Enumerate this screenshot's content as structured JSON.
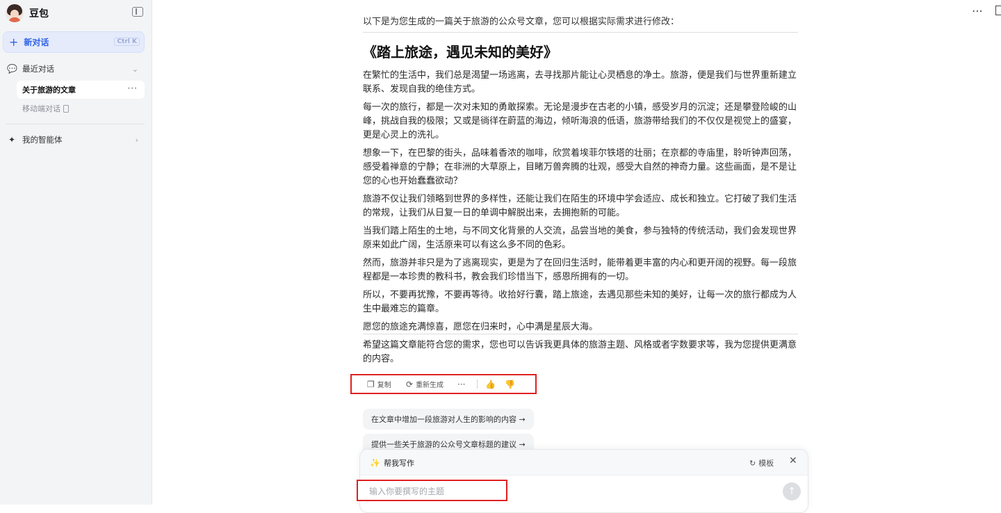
{
  "sidebar": {
    "brand_name": "豆包",
    "new_chat_label": "新对话",
    "new_chat_shortcut": "Ctrl K",
    "recent_label": "最近对话",
    "recent_items": [
      {
        "label": "关于旅游的文章",
        "active": true
      }
    ],
    "mobile_label": "移动端对话",
    "agents_label": "我的智能体"
  },
  "main": {
    "intro": "以下是为您生成的一篇关于旅游的公众号文章，您可以根据实际需求进行修改：",
    "title": "《踏上旅途，遇见未知的美好》",
    "paragraphs": [
      "在繁忙的生活中，我们总是渴望一场逃离，去寻找那片能让心灵栖息的净土。旅游，便是我们与世界重新建立联系、发现自我的绝佳方式。",
      "每一次的旅行，都是一次对未知的勇敢探索。无论是漫步在古老的小镇，感受岁月的沉淀；还是攀登险峻的山峰，挑战自我的极限；又或是徜徉在蔚蓝的海边，倾听海浪的低语，旅游带给我们的不仅仅是视觉上的盛宴，更是心灵上的洗礼。",
      "想象一下，在巴黎的街头，品味着香浓的咖啡，欣赏着埃菲尔铁塔的壮丽；在京都的寺庙里，聆听钟声回荡，感受着禅意的宁静；在非洲的大草原上，目睹万兽奔腾的壮观，感受大自然的神奇力量。这些画面，是不是让您的心也开始蠢蠢欲动？",
      "旅游不仅让我们领略到世界的多样性，还能让我们在陌生的环境中学会适应、成长和独立。它打破了我们生活的常规，让我们从日复一日的单调中解脱出来，去拥抱新的可能。",
      "当我们踏上陌生的土地，与不同文化背景的人交流，品尝当地的美食，参与独特的传统活动，我们会发现世界原来如此广阔，生活原来可以有这么多不同的色彩。",
      "然而，旅游并非只是为了逃离现实，更是为了在回归生活时，能带着更丰富的内心和更开阔的视野。每一段旅程都是一本珍贵的教科书，教会我们珍惜当下，感恩所拥有的一切。",
      "所以，不要再犹豫，不要再等待。收拾好行囊，踏上旅途，去遇见那些未知的美好，让每一次的旅行都成为人生中最难忘的篇章。",
      "愿您的旅途充满惊喜，愿您在归来时，心中满是星辰大海。"
    ],
    "outro": "希望这篇文章能符合您的需求，您也可以告诉我更具体的旅游主题、风格或者字数要求等，我为您提供更满意的内容。",
    "actions": {
      "copy_label": "复制",
      "regenerate_label": "重新生成"
    },
    "suggestions": [
      "在文章中增加一段旅游对人生的影响的内容 →",
      "提供一些关于旅游的公众号文章标题的建议 →"
    ]
  },
  "composer": {
    "mode_label": "帮我写作",
    "template_label": "模板",
    "input_placeholder": "输入你要撰写的主题",
    "input_value": ""
  },
  "colors": {
    "accent": "#2f62e6",
    "highlight_border": "#e02020",
    "sidebar_bg": "#f3f4f6"
  }
}
